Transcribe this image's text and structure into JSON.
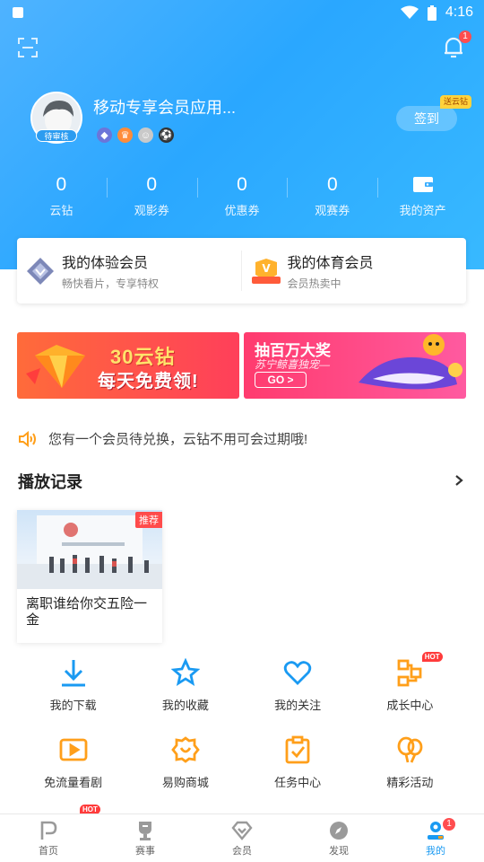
{
  "status_bar": {
    "time": "4:16"
  },
  "header": {
    "notification_count": "1",
    "username": "移动专享会员应用...",
    "avatar_badge": "待审核",
    "level_icons": [
      "diamond-level-icon",
      "crown-level-icon",
      "cat-level-icon",
      "soccer-level-icon"
    ],
    "signin_label": "签到",
    "signin_tag": "送云钻"
  },
  "stats": [
    {
      "value": "0",
      "label": "云钻"
    },
    {
      "value": "0",
      "label": "观影券"
    },
    {
      "value": "0",
      "label": "优惠券"
    },
    {
      "value": "0",
      "label": "观赛券"
    },
    {
      "value": "",
      "label": "我的资产"
    }
  ],
  "membership": {
    "experience": {
      "title": "我的体验会员",
      "subtitle": "畅快看片，专享特权"
    },
    "sports": {
      "title": "我的体育会员",
      "subtitle": "会员热卖中"
    }
  },
  "banners": {
    "left": {
      "title": "30云钻",
      "subtitle": "每天免费领!"
    },
    "right": {
      "title": "抽百万大奖",
      "subtitle": "苏宁鲸喜独宠—",
      "button": "GO >"
    }
  },
  "notice": {
    "text": "您有一个会员待兑换，云钻不用可会过期哦!"
  },
  "history": {
    "title": "播放记录",
    "items": [
      {
        "tag": "推荐",
        "title": "离职谁给你交五险一金"
      }
    ]
  },
  "grid_row1": [
    {
      "label": "我的下载",
      "icon": "download-icon"
    },
    {
      "label": "我的收藏",
      "icon": "star-icon"
    },
    {
      "label": "我的关注",
      "icon": "heart-icon"
    },
    {
      "label": "成长中心",
      "icon": "growth-icon",
      "hot": "HOT"
    }
  ],
  "grid_row2": [
    {
      "label": "免流量看剧",
      "icon": "play-icon"
    },
    {
      "label": "易购商城",
      "icon": "mall-icon"
    },
    {
      "label": "任务中心",
      "icon": "task-icon"
    },
    {
      "label": "精彩活动",
      "icon": "balloon-icon"
    }
  ],
  "grid_row3_hot": "HOT",
  "tabbar": [
    {
      "label": "首页",
      "icon": "home-icon"
    },
    {
      "label": "赛事",
      "icon": "trophy-icon"
    },
    {
      "label": "会员",
      "icon": "diamond-icon"
    },
    {
      "label": "发现",
      "icon": "compass-icon"
    },
    {
      "label": "我的",
      "icon": "profile-icon",
      "badge": "1",
      "active": true
    }
  ],
  "colors": {
    "accent": "#1a9af2",
    "orange": "#ff9f1a",
    "header_blue": "#2aa7ff",
    "badge_red": "#ff4d4f"
  }
}
